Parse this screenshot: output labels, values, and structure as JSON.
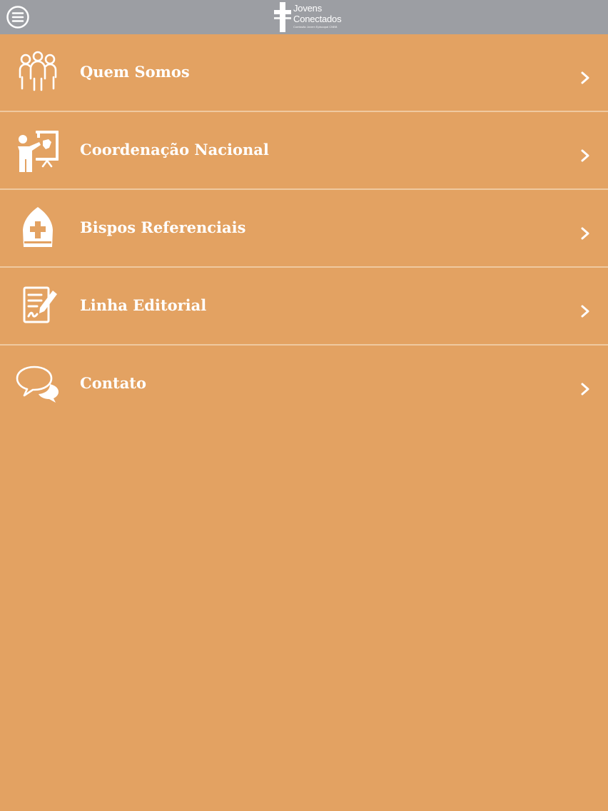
{
  "header": {
    "logo_line1": "Jovens",
    "logo_line2": "Conectados",
    "logo_sub": "Comissão Jovem Episcopal CNBB",
    "background_color": "#9C9EA3"
  },
  "menu": {
    "background_color": "#E3A262",
    "divider_color": "#EFC9A0",
    "items": [
      {
        "label": "Quem Somos",
        "icon": "people-group-icon"
      },
      {
        "label": "Coordenação Nacional",
        "icon": "presenter-board-icon"
      },
      {
        "label": "Bispos Referenciais",
        "icon": "mitre-icon"
      },
      {
        "label": "Linha Editorial",
        "icon": "document-pen-icon"
      },
      {
        "label": "Contato",
        "icon": "chat-bubbles-icon"
      }
    ]
  }
}
